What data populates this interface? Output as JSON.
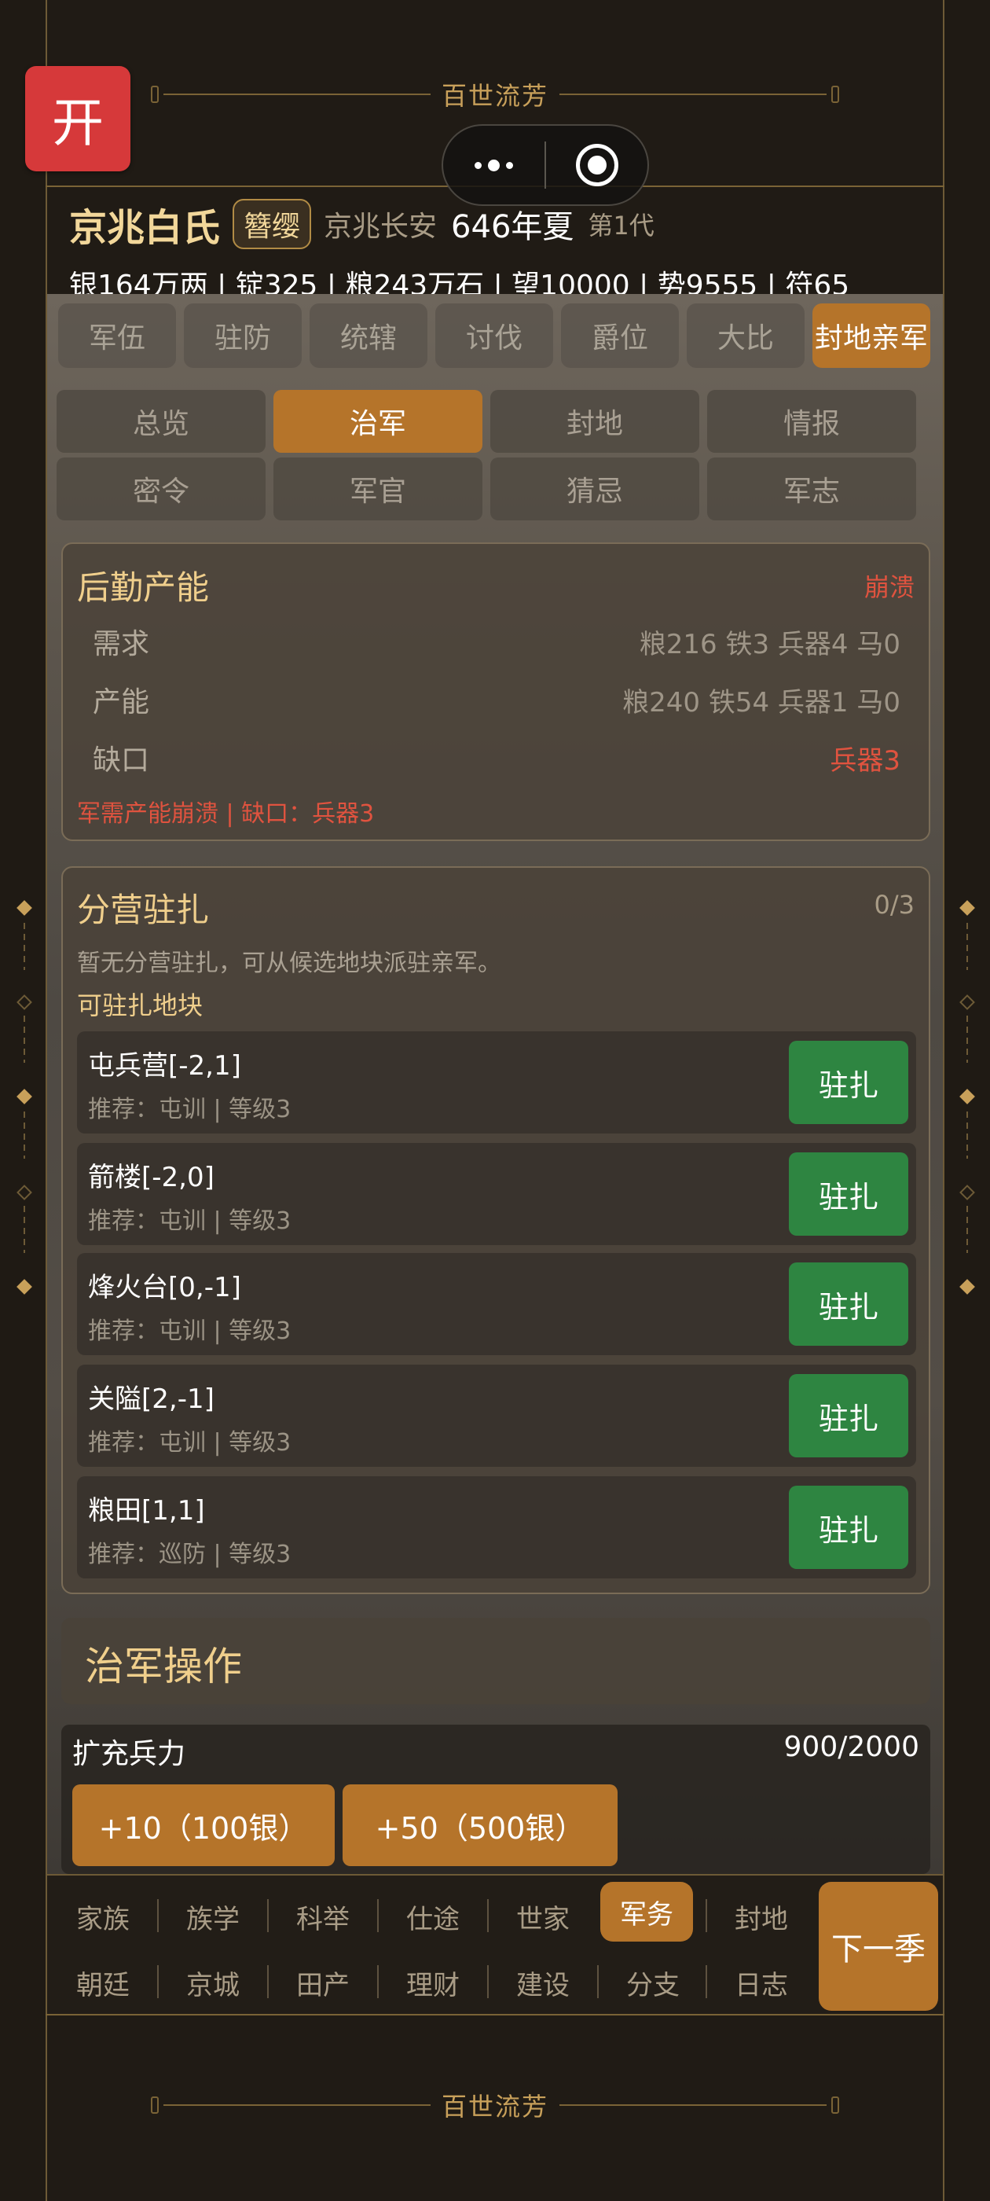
{
  "app": {
    "title": "百世流芳",
    "open_label": "开"
  },
  "header": {
    "clan": "京兆白氏",
    "tag": "簪缨",
    "city": "京兆长安",
    "season": "646年夏",
    "generation": "第1代",
    "resources": "银164万两 | 锭325 | 粮243万石 | 望10000 | 势9555 | 符65"
  },
  "tabs": [
    "军伍",
    "驻防",
    "统辖",
    "讨伐",
    "爵位",
    "大比",
    "封地亲军"
  ],
  "active_tab": "封地亲军",
  "subtabs": [
    "总览",
    "治军",
    "封地",
    "情报",
    "密令",
    "军官",
    "猜忌",
    "军志"
  ],
  "active_subtab": "治军",
  "logistics": {
    "title": "后勤产能",
    "status": "崩溃",
    "rows": [
      {
        "label": "需求",
        "value": "粮216 铁3 兵器4 马0"
      },
      {
        "label": "产能",
        "value": "粮240 铁54 兵器1 马0"
      },
      {
        "label": "缺口",
        "value": "兵器3"
      }
    ],
    "warning": "军需产能崩溃 | 缺口：兵器3"
  },
  "camps": {
    "title": "分营驻扎",
    "count": "0/3",
    "hint": "暂无分营驻扎，可从候选地块派驻亲军。",
    "subtitle": "可驻扎地块",
    "button_label": "驻扎",
    "sites": [
      {
        "name": "屯兵营[-2,1]",
        "meta": "推荐：屯训 | 等级3"
      },
      {
        "name": "箭楼[-2,0]",
        "meta": "推荐：屯训 | 等级3"
      },
      {
        "name": "烽火台[0,-1]",
        "meta": "推荐：屯训 | 等级3"
      },
      {
        "name": "关隘[2,-1]",
        "meta": "推荐：屯训 | 等级3"
      },
      {
        "name": "粮田[1,1]",
        "meta": "推荐：巡防 | 等级3"
      }
    ]
  },
  "operations": {
    "title": "治军操作",
    "expand_title": "扩充兵力",
    "expand_count": "900/2000",
    "buttons": [
      "+10（100银）",
      "+50（500银）"
    ]
  },
  "bottom_nav": {
    "row1": [
      "家族",
      "族学",
      "科举",
      "仕途",
      "世家",
      "军务",
      "封地"
    ],
    "row2": [
      "朝廷",
      "京城",
      "田产",
      "理财",
      "建设",
      "分支",
      "日志"
    ],
    "active": "军务",
    "next_label": "下一季"
  },
  "colors": {
    "accent": "#b5742a",
    "gold_text": "#f0cf8c",
    "danger": "#e0533f",
    "station_button": "#2e8541"
  }
}
